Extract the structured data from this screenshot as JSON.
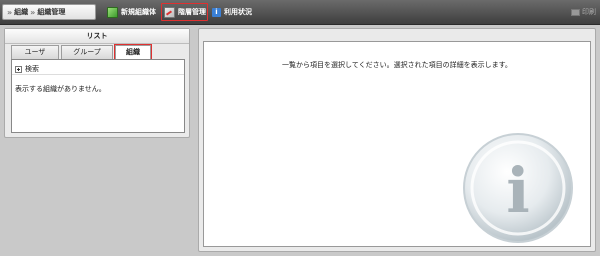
{
  "breadcrumb": [
    "組織",
    "組織管理"
  ],
  "toolbar": {
    "new_org_label": "新規組織体",
    "hierarchy_label": "階層管理",
    "usage_label": "利用状況",
    "print_label": "印刷"
  },
  "left_panel": {
    "title": "リスト",
    "tabs": [
      {
        "label": "ユーザ"
      },
      {
        "label": "グループ"
      },
      {
        "label": "組織"
      }
    ],
    "search_label": "検索",
    "empty_message": "表示する組織がありません。"
  },
  "right_panel": {
    "message": "一覧から項目を選択してください。選択された項目の詳細を表示します。",
    "info_glyph": "i"
  },
  "colors": {
    "toolbar_bg": "#4f4f4f",
    "highlight": "#e03030",
    "panel_bg": "#eaeaea"
  },
  "icons": [
    "breadcrumb-arrow-icon",
    "new-org-icon",
    "hierarchy-icon",
    "info-icon",
    "print-icon",
    "plus-icon",
    "info-watermark-icon"
  ]
}
